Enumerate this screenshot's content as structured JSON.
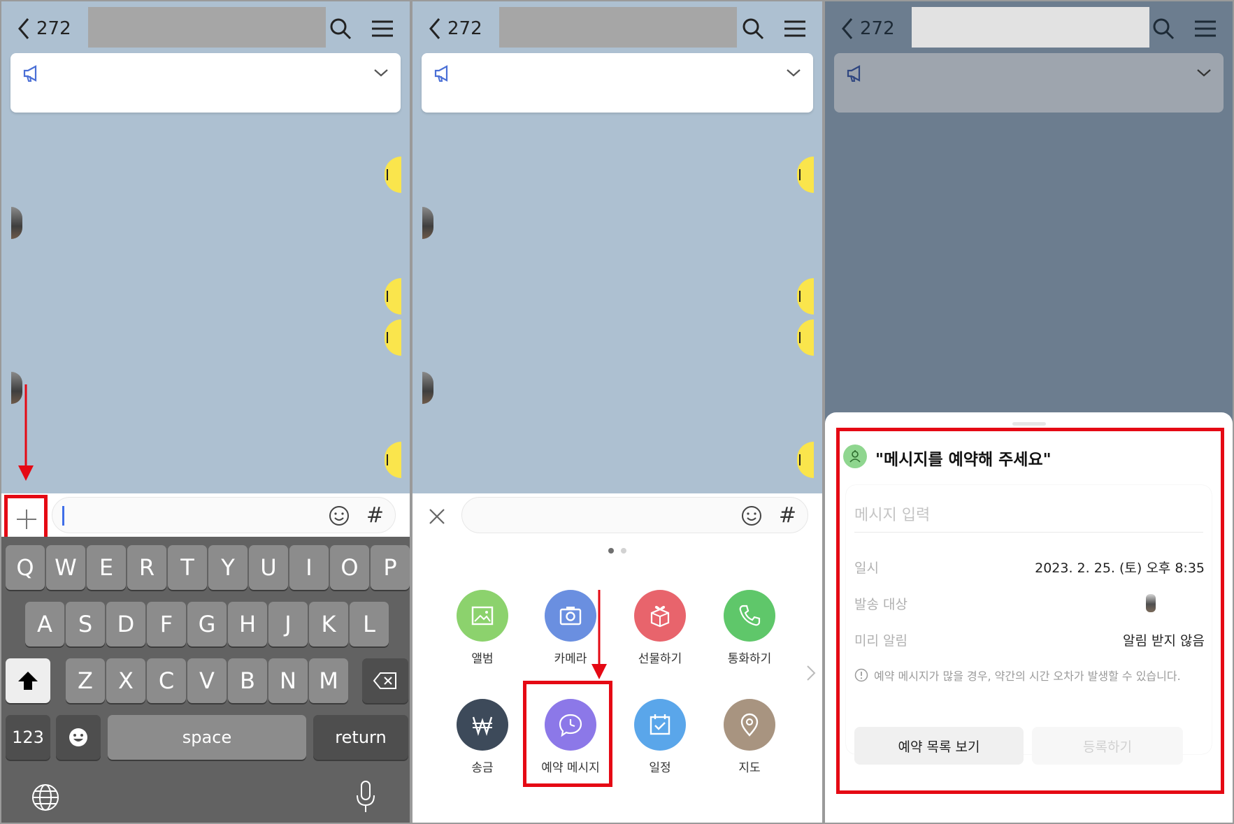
{
  "chat": {
    "member_count": "272",
    "keyboard_title": "",
    "icons": [
      "back-chevron-icon",
      "search-icon",
      "menu-icon",
      "megaphone-icon",
      "chevron-down-icon"
    ]
  },
  "panel1": {
    "keyboard": {
      "row1": [
        "Q",
        "W",
        "E",
        "R",
        "T",
        "Y",
        "U",
        "I",
        "O",
        "P"
      ],
      "row2": [
        "A",
        "S",
        "D",
        "F",
        "G",
        "H",
        "J",
        "K",
        "L"
      ],
      "row3": [
        "Z",
        "X",
        "C",
        "V",
        "B",
        "N",
        "M"
      ],
      "numbers_label": "123",
      "space_label": "space",
      "return_label": "return"
    },
    "hash_label": "#"
  },
  "panel2": {
    "hash_label": "#",
    "attachments": [
      {
        "label": "앨범",
        "color": "#8cd26d",
        "icon": "album-icon"
      },
      {
        "label": "카메라",
        "color": "#6a8fe0",
        "icon": "camera-icon"
      },
      {
        "label": "선물하기",
        "color": "#e8646c",
        "icon": "gift-icon"
      },
      {
        "label": "통화하기",
        "color": "#5fc76a",
        "icon": "phone-icon"
      },
      {
        "label": "송금",
        "color": "#3d4a5a",
        "icon": "won-icon"
      },
      {
        "label": "예약 메시지",
        "color": "#8c78e8",
        "icon": "scheduled-message-icon"
      },
      {
        "label": "일정",
        "color": "#5aa6ea",
        "icon": "calendar-icon"
      },
      {
        "label": "지도",
        "color": "#a89480",
        "icon": "map-pin-icon"
      }
    ]
  },
  "panel3": {
    "sheet_title": "\"메시지를 예약해 주세요\"",
    "message_placeholder": "메시지 입력",
    "datetime_label": "일시",
    "datetime_value": "2023. 2. 25. (토) 오후 8:35",
    "target_label": "발송 대상",
    "reminder_label": "미리 알림",
    "reminder_value": "알림 받지 않음",
    "notice_text": "예약 메시지가 많을 경우, 약간의 시간 오차가 발생할 수 있습니다.",
    "list_button": "예약 목록 보기",
    "register_button": "등록하기"
  },
  "colors": {
    "chat_bg": "#adc0d1",
    "dim_bg": "#6c7d8f",
    "highlight_red": "#e50914",
    "kakao_yellow": "#fae54c"
  }
}
